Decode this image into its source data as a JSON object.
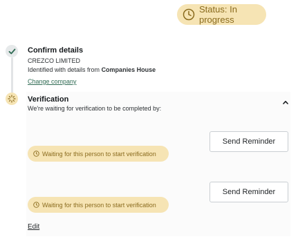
{
  "status": {
    "label": "Status: In progress",
    "icon": "clock-icon",
    "color": "#f6e4b4"
  },
  "steps": [
    {
      "title": "Confirm details",
      "state": "done",
      "company_name": "CREZCO LIMITED",
      "identified_prefix": "Identified with details from ",
      "identified_source": "Companies House",
      "change_link": "Change company"
    },
    {
      "title": "Verification",
      "state": "in-progress",
      "subtitle": "We're waiting for verification to be completed by:",
      "people": [
        {
          "status": "Waiting for this person to start verification",
          "reminder_label": "Send Reminder"
        },
        {
          "status": "Waiting for this person to start verification",
          "reminder_label": "Send Reminder"
        }
      ],
      "edit_label": "Edit"
    }
  ]
}
